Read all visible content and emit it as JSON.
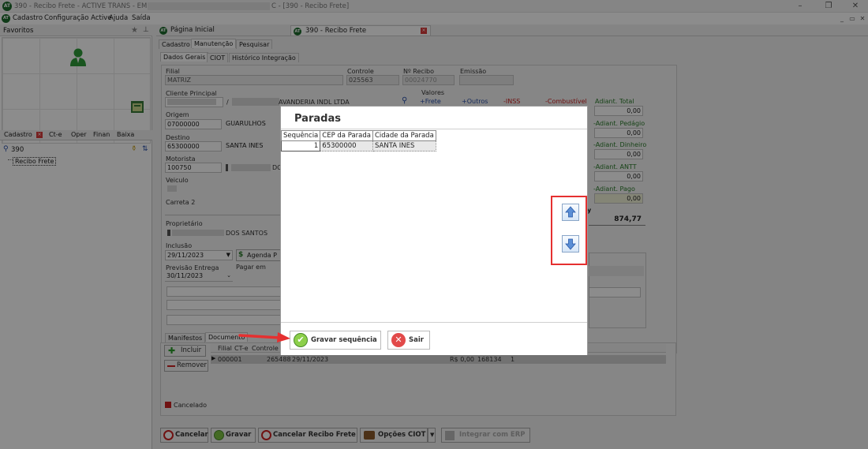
{
  "window": {
    "title_left": "390 - Recibo Frete - ACTIVE TRANS - EMPRESA:",
    "title_right": "C - [390 - Recibo Frete]",
    "logo": "AT"
  },
  "menu": {
    "items": [
      "Cadastro",
      "Configuração Active",
      "Ajuda",
      "Saída"
    ]
  },
  "left": {
    "favorites_label": "Favoritos",
    "nav_tabs": [
      "Cadastro",
      "Ct-e",
      "Oper",
      "Finan",
      "Baixa"
    ],
    "search_value": "390",
    "tree_item": "Recibo Frete"
  },
  "doc_tabs": {
    "home": "Página Inicial",
    "current": "390 - Recibo Frete"
  },
  "subtabs": [
    "Cadastro",
    "Manutenção",
    "Pesquisar"
  ],
  "form_tabs": [
    "Dados Gerais",
    "CIOT",
    "Histórico Integração"
  ],
  "form": {
    "filial_label": "Filial",
    "filial_value": "MATRIZ",
    "controle_label": "Controle",
    "controle_value": "025563",
    "nrecibo_label": "Nº Recibo",
    "nrecibo_value": "00024770",
    "emissao_label": "Emissão",
    "cliente_label": "Cliente Principal",
    "cliente_name": "AVANDERIA INDL LTDA",
    "cliente_sep": "/",
    "origem_label": "Origem",
    "origem_cep": "07000000",
    "origem_city": "GUARULHOS",
    "destino_label": "Destino",
    "destino_cep": "65300000",
    "destino_city": "SANTA INES",
    "motorista_label": "Motorista",
    "motorista_code": "100750",
    "motorista_name": "DO",
    "veiculo_label": "Veiculo",
    "carreta_label": "Carreta 2",
    "proprietario_label": "Proprietário",
    "proprietario_name": "DOS SANTOS",
    "inclusao_label": "Inclusão",
    "inclusao_value": "29/11/2023",
    "agenda_label": "Agenda P",
    "previsao_label": "Previsão Entrega",
    "previsao_value": "30/11/2023",
    "pagar_label": "Pagar em"
  },
  "valores": {
    "title": "Valores",
    "frete": "+Frete",
    "outros": "+Outros",
    "inss": "-INSS",
    "combustivel": "-Combustível",
    "adiant_total_label": "Adiant. Total",
    "adiant_total_value": "0,00",
    "adiant_pedagio_label": "-Adiant. Pedágio",
    "adiant_pedagio_value": "0,00",
    "adiant_dinheiro_label": "-Adiant. Dinheiro",
    "adiant_dinheiro_value": "0,00",
    "adiant_antt_label": "-Adiant. ANTT",
    "adiant_antt_value": "0,00",
    "adiant_pago_label": "-Adiant. Pago",
    "adiant_pago_value": "0,00",
    "total_value": "874,77",
    "partial_y": "y"
  },
  "lower": {
    "tabs": [
      "Manifestos",
      "Documento"
    ],
    "incluir": "Incluir",
    "remover": "Remover",
    "cancelado": "Cancelado",
    "grid_headers": [
      "Filial",
      "CT-e",
      "Controle"
    ],
    "row": {
      "filial": "000001",
      "cte": "265488",
      "data": "29/11/2023",
      "valor": "R$ 0,00",
      "num": "168134",
      "extra": "1"
    }
  },
  "bottom_buttons": {
    "cancelar": "Cancelar",
    "gravar": "Gravar",
    "cancelar_recibo": "Cancelar Recibo Frete",
    "opcoes_ciot": "Opções CIOT",
    "integrar": "Integrar com ERP"
  },
  "dialog": {
    "title": "Paradas",
    "columns": [
      "Sequência",
      "CEP da Parada",
      "Cidade da Parada"
    ],
    "rows": [
      {
        "seq": "1",
        "cep": "65300000",
        "cidade": "SANTA INES"
      }
    ],
    "gravar_label": "Gravar sequência",
    "sair_label": "Sair"
  },
  "colors": {
    "accent_red": "#e53030",
    "green": "#2a7a2a",
    "blue": "#2a4fa8"
  }
}
